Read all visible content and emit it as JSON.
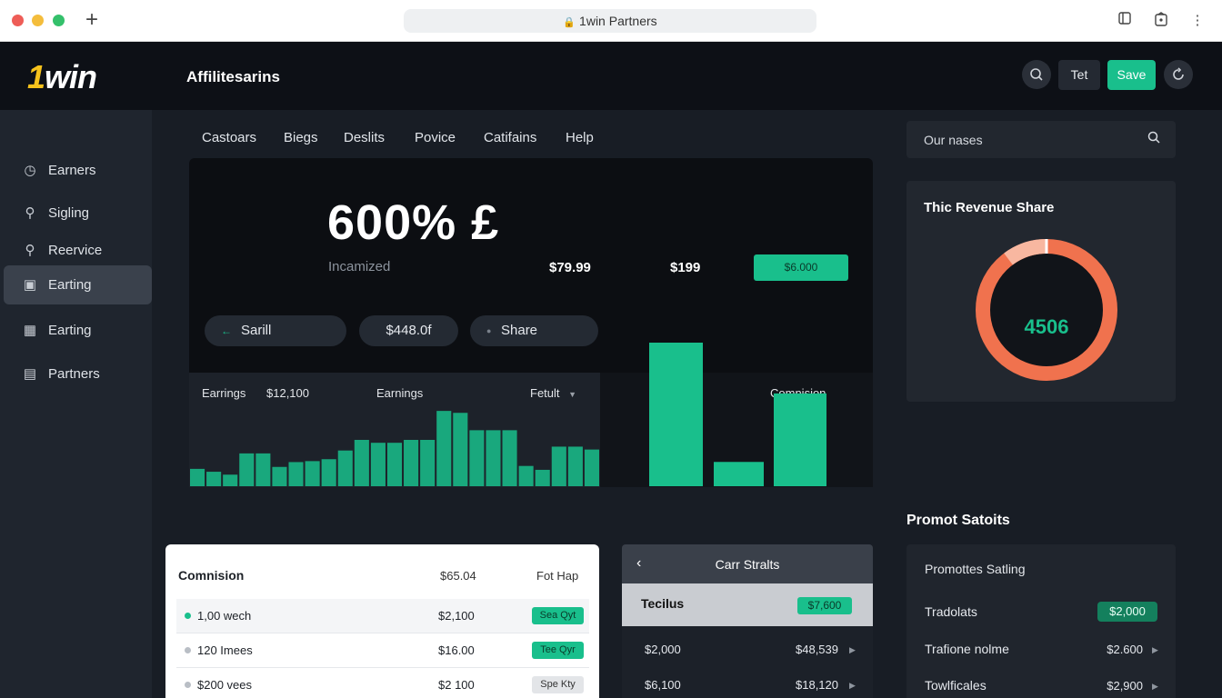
{
  "browser": {
    "url_title": "1win Partners"
  },
  "app": {
    "logo_one": "1",
    "logo_rest": "win",
    "title": "Affilitesarins",
    "tet_label": "Tet",
    "save_label": "Save"
  },
  "sidebar": {
    "items": [
      {
        "label": "Earners",
        "icon": "clock-icon"
      },
      {
        "label": "Sigling",
        "icon": "search-icon"
      },
      {
        "label": "Reervice",
        "icon": "key-icon"
      },
      {
        "label": "Earting",
        "icon": "wallet-icon",
        "active": true
      },
      {
        "label": "Earting",
        "icon": "building-icon"
      },
      {
        "label": "Partners",
        "icon": "briefcase-icon"
      }
    ]
  },
  "nav": {
    "tabs": [
      "Castoars",
      "Biegs",
      "Deslits",
      "Povice",
      "Catifains",
      "Help"
    ]
  },
  "hero": {
    "big_stat": "600% £",
    "subtitle": "Incamized",
    "value_1": "$79.99",
    "value_2": "$199",
    "chip": "$6.000",
    "pills": [
      "Sarill",
      "$448.0f",
      "Share"
    ]
  },
  "earnings": {
    "label_1": "Earrings",
    "value": "$12,100",
    "label_2": "Earnings",
    "filter": "Fetult",
    "commission_label": "Comnision"
  },
  "chart_data": [
    {
      "type": "bar",
      "values": [
        18,
        15,
        12,
        34,
        34,
        20,
        25,
        26,
        28,
        37,
        48,
        45,
        45,
        48,
        48,
        78,
        76,
        58,
        58,
        58,
        21,
        17,
        41,
        41,
        38
      ]
    },
    {
      "type": "bar",
      "values": [
        130,
        22,
        84
      ]
    }
  ],
  "search": {
    "placeholder": "Our nases"
  },
  "revenue": {
    "title": "Thic Revenue Share",
    "center_value": "4506",
    "ring_color": "#f0724e",
    "ring_highlight": "#f8b7a0"
  },
  "promo": {
    "title": "Promot Satoits",
    "subtitle": "Promottes Satling",
    "rows": [
      {
        "name": "Tradolats",
        "value": "$2,000",
        "chip": true
      },
      {
        "name": "Trafione nolme",
        "value": "$2.600"
      },
      {
        "name": "Towlficales",
        "value": "$2,900"
      }
    ]
  },
  "commission_table": {
    "title": "Comnision",
    "col_2": "$65.04",
    "col_3": "Fot Hap",
    "rows": [
      {
        "name": "1,00 wech",
        "value": "$2,100",
        "badge": "Sea Qyt",
        "badge_style": "green",
        "dot": "#19bf8c"
      },
      {
        "name": "120 Imees",
        "value": "$16.00",
        "badge": "Tee Qyr",
        "badge_style": "green",
        "dot": "#b9bec5"
      },
      {
        "name": "$200 vees",
        "value": "$2 100",
        "badge": "Spe Kty",
        "badge_style": "gray",
        "dot": "#b9bec5"
      }
    ]
  },
  "stats": {
    "title": "Carr Stralts",
    "highlight_label": "Tecilus",
    "highlight_chip": "$7,600",
    "rows": [
      {
        "left": "$2,000",
        "right": "$48,539"
      },
      {
        "left": "$6,100",
        "right": "$18,120"
      }
    ]
  },
  "colors": {
    "accent": "#19bf8c",
    "brand_yellow": "#f6c21c",
    "background": "#181d25"
  }
}
